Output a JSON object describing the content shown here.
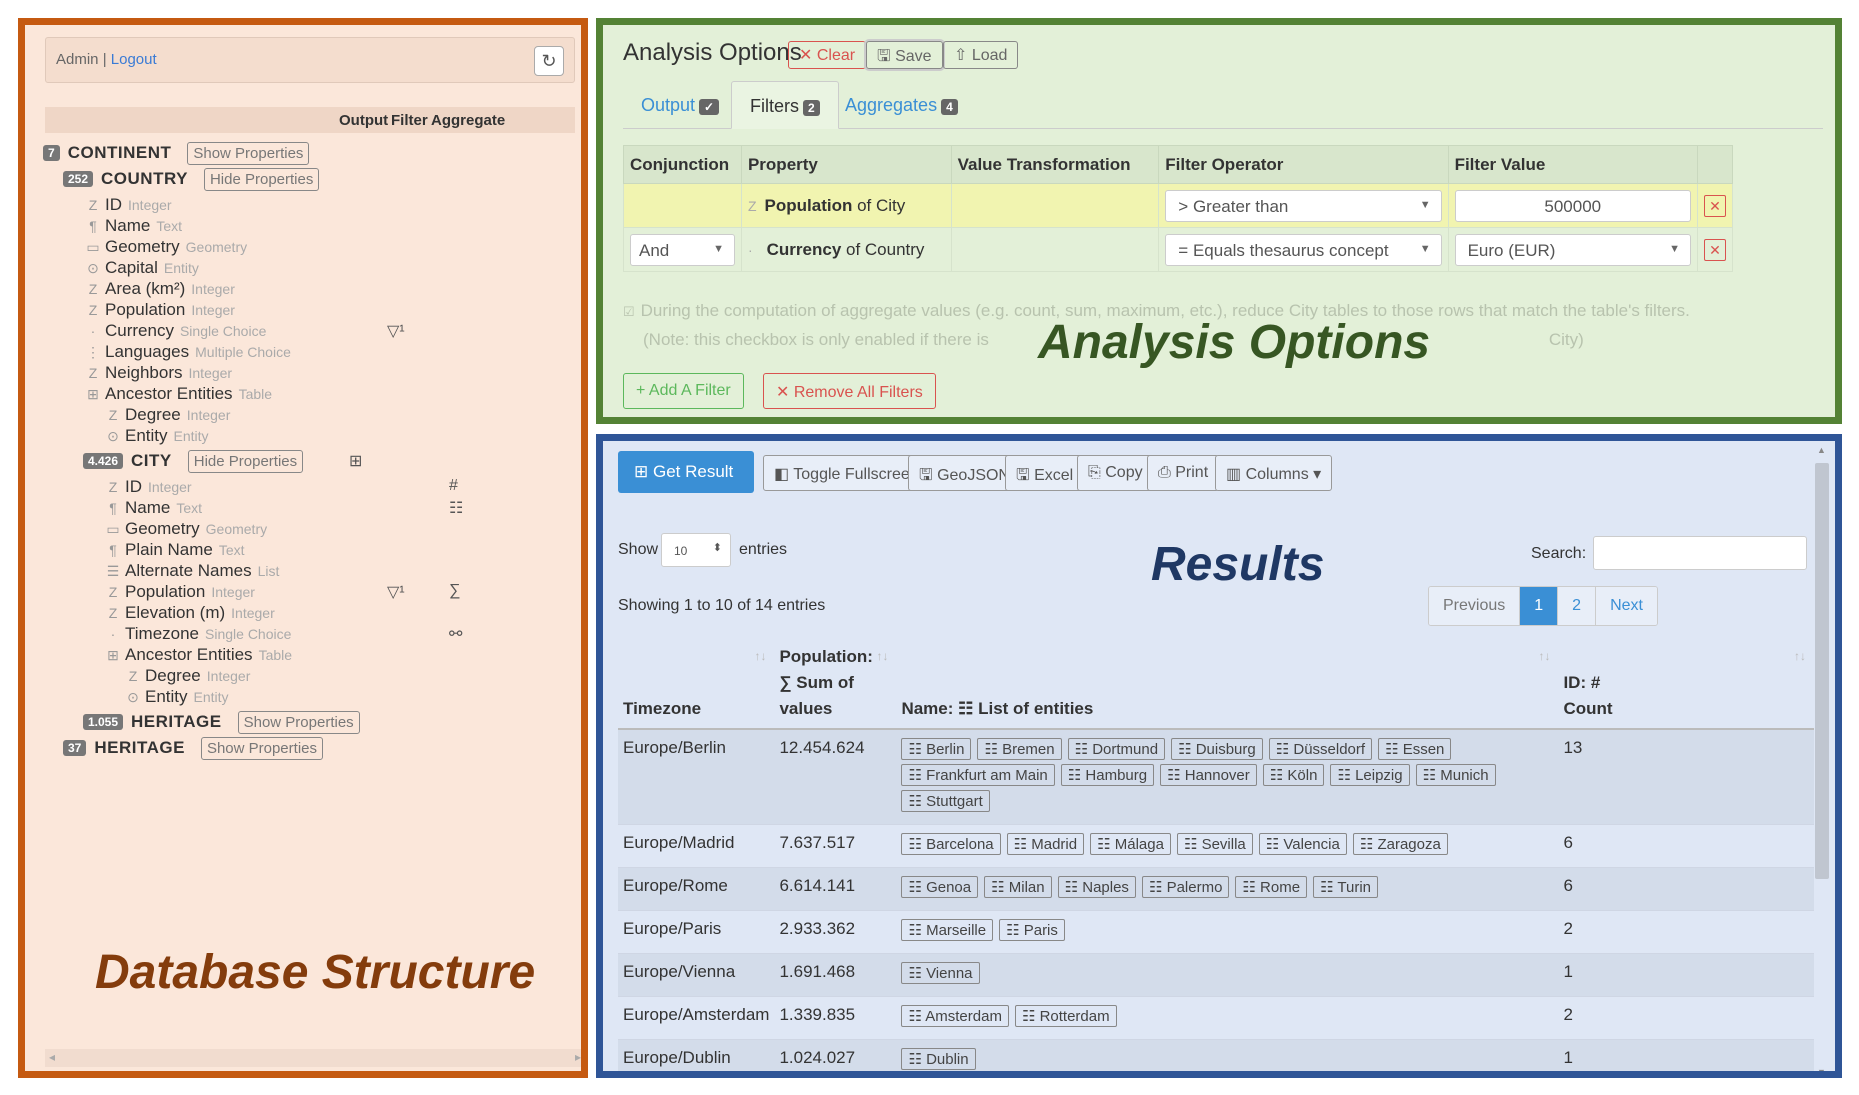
{
  "left": {
    "user": "Admin",
    "sep": " | ",
    "logout": "Logout",
    "col_headers": [
      "Output",
      "Filter",
      "Aggregate"
    ],
    "watermark": "Database Structure"
  },
  "tree": {
    "continent": {
      "count": "7",
      "name": "CONTINENT",
      "btn": "Show Properties"
    },
    "country": {
      "count": "252",
      "name": "COUNTRY",
      "btn": "Hide Properties"
    },
    "country_props": [
      {
        "icon": "Z",
        "name": "ID",
        "type": "Integer"
      },
      {
        "icon": "¶",
        "name": "Name",
        "type": "Text"
      },
      {
        "icon": "▭",
        "name": "Geometry",
        "type": "Geometry"
      },
      {
        "icon": "⊙",
        "name": "Capital",
        "type": "Entity"
      },
      {
        "icon": "Z",
        "name": "Area (km²)",
        "type": "Integer"
      },
      {
        "icon": "Z",
        "name": "Population",
        "type": "Integer"
      },
      {
        "icon": "·",
        "name": "Currency",
        "type": "Single Choice"
      },
      {
        "icon": "⋮",
        "name": "Languages",
        "type": "Multiple Choice"
      },
      {
        "icon": "Z",
        "name": "Neighbors",
        "type": "Integer"
      },
      {
        "icon": "⊞",
        "name": "Ancestor Entities",
        "type": "Table"
      }
    ],
    "country_sub": [
      {
        "icon": "Z",
        "name": "Degree",
        "type": "Integer"
      },
      {
        "icon": "⊙",
        "name": "Entity",
        "type": "Entity"
      }
    ],
    "currency_filter": "▽¹",
    "city": {
      "count": "4.426",
      "name": "CITY",
      "btn": "Hide Properties"
    },
    "city_props": [
      {
        "icon": "Z",
        "name": "ID",
        "type": "Integer"
      },
      {
        "icon": "¶",
        "name": "Name",
        "type": "Text"
      },
      {
        "icon": "▭",
        "name": "Geometry",
        "type": "Geometry"
      },
      {
        "icon": "¶",
        "name": "Plain Name",
        "type": "Text"
      },
      {
        "icon": "☰",
        "name": "Alternate Names",
        "type": "List"
      },
      {
        "icon": "Z",
        "name": "Population",
        "type": "Integer"
      },
      {
        "icon": "Z",
        "name": "Elevation (m)",
        "type": "Integer"
      },
      {
        "icon": "·",
        "name": "Timezone",
        "type": "Single Choice"
      },
      {
        "icon": "⊞",
        "name": "Ancestor Entities",
        "type": "Table"
      }
    ],
    "city_sub": [
      {
        "icon": "Z",
        "name": "Degree",
        "type": "Integer"
      },
      {
        "icon": "⊙",
        "name": "Entity",
        "type": "Entity"
      }
    ],
    "city_marks": {
      "table": "⊞",
      "id": "#",
      "name": "☷",
      "pop_filter": "▽¹",
      "pop_agg": "∑",
      "tz": "⚯"
    },
    "heritage1": {
      "count": "1.055",
      "name": "HERITAGE",
      "btn": "Show Properties"
    },
    "heritage2": {
      "count": "37",
      "name": "HERITAGE",
      "btn": "Show Properties"
    }
  },
  "options": {
    "title": "Analysis Options",
    "clear": "✕ Clear",
    "save": "🖫 Save",
    "load": "⇧ Load",
    "tabs": [
      {
        "label": "Output",
        "badge": "✓"
      },
      {
        "label": "Filters",
        "badge": "2"
      },
      {
        "label": "Aggregates",
        "badge": "4"
      }
    ],
    "headers": [
      "Conjunction",
      "Property",
      "Value Transformation",
      "Filter Operator",
      "Filter Value"
    ],
    "row1": {
      "prop_bold": "Population",
      "prop_rest": " of City",
      "operator": ">   Greater than",
      "value": "500000"
    },
    "row2": {
      "conj": "And",
      "prop_bold": "Currency",
      "prop_rest": " of Country",
      "operator": "=   Equals thesaurus concept",
      "value": "Euro (EUR)"
    },
    "note_line1": "During the computation of aggregate values (e.g. count, sum, maximum, etc.), reduce City tables to those rows that match the table's filters.",
    "note_line2": "(Note: this checkbox is only enabled if there is",
    "note_line2_end": "City)",
    "add_filter": "+ Add A Filter",
    "remove_filters": "✕ Remove All Filters",
    "watermark": "Analysis Options"
  },
  "results": {
    "get_result": "⊞ Get Result",
    "tools": [
      "◧ Toggle Fullscreen",
      "🖫 GeoJSON",
      "🖫 Excel",
      "⎘ Copy",
      "⎙ Print",
      "▥ Columns ▾"
    ],
    "show": "Show",
    "entries_value": "10",
    "entries": "entries",
    "search": "Search:",
    "showing": "Showing 1 to 10 of 14 entries",
    "pager": [
      "Previous",
      "1",
      "2",
      "Next"
    ],
    "watermark": "Results",
    "col_timezone": "Timezone",
    "col_pop_1": "Population:",
    "col_pop_2": "∑ Sum of",
    "col_pop_3": "values",
    "col_name": "Name: ☷ List of entities",
    "col_id_1": "ID: #",
    "col_id_2": "Count",
    "rows": [
      {
        "tz": "Europe/Berlin",
        "pop": "12.454.624",
        "count": "13",
        "names": [
          "Berlin",
          "Bremen",
          "Dortmund",
          "Duisburg",
          "Düsseldorf",
          "Essen",
          "Frankfurt am Main",
          "Hamburg",
          "Hannover",
          "Köln",
          "Leipzig",
          "Munich",
          "Stuttgart"
        ]
      },
      {
        "tz": "Europe/Madrid",
        "pop": "7.637.517",
        "count": "6",
        "names": [
          "Barcelona",
          "Madrid",
          "Málaga",
          "Sevilla",
          "Valencia",
          "Zaragoza"
        ]
      },
      {
        "tz": "Europe/Rome",
        "pop": "6.614.141",
        "count": "6",
        "names": [
          "Genoa",
          "Milan",
          "Naples",
          "Palermo",
          "Rome",
          "Turin"
        ]
      },
      {
        "tz": "Europe/Paris",
        "pop": "2.933.362",
        "count": "2",
        "names": [
          "Marseille",
          "Paris"
        ]
      },
      {
        "tz": "Europe/Vienna",
        "pop": "1.691.468",
        "count": "1",
        "names": [
          "Vienna"
        ]
      },
      {
        "tz": "Europe/Amsterdam",
        "pop": "1.339.835",
        "count": "2",
        "names": [
          "Amsterdam",
          "Rotterdam"
        ]
      },
      {
        "tz": "Europe/Dublin",
        "pop": "1.024.027",
        "count": "1",
        "names": [
          "Dublin"
        ]
      }
    ]
  },
  "colors": {
    "left_border": "#c55a11",
    "options_border": "#548235",
    "results_border": "#2f5597",
    "accent": "#3a8fd5"
  }
}
